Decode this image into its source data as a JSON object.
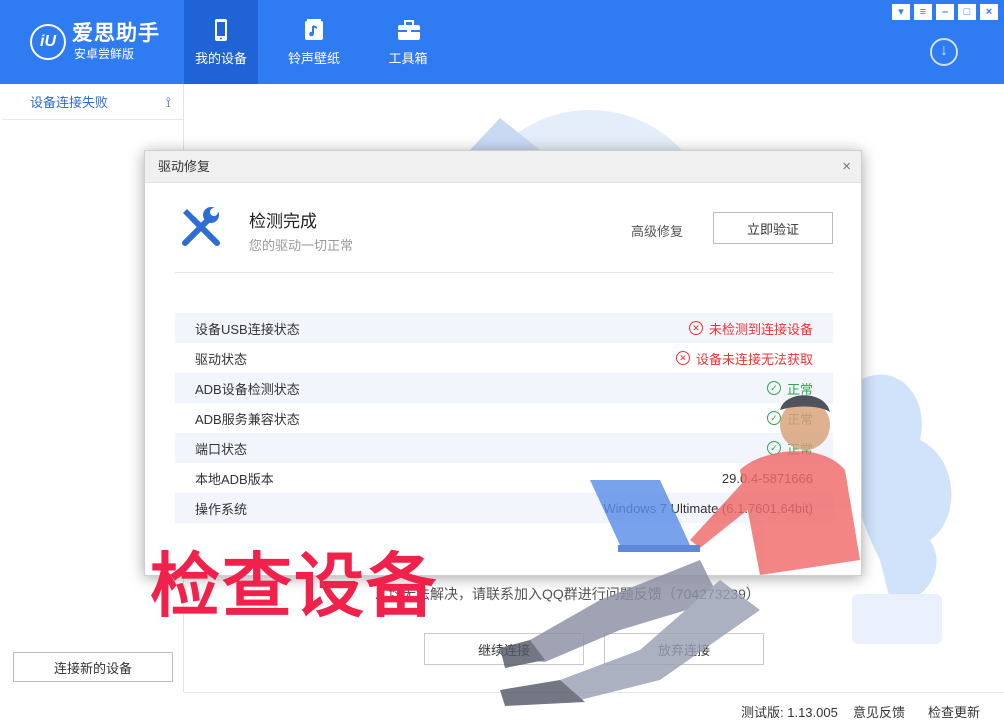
{
  "app": {
    "logo_mark": "iU",
    "logo_title": "爱思助手",
    "logo_subtitle": "安卓尝鲜版"
  },
  "nav": [
    {
      "label": "我的设备",
      "icon": "phone-icon",
      "active": true
    },
    {
      "label": "铃声壁纸",
      "icon": "music-icon",
      "active": false
    },
    {
      "label": "工具箱",
      "icon": "toolbox-icon",
      "active": false
    }
  ],
  "window_buttons": [
    "skin-icon",
    "menu-icon",
    "minimize-icon",
    "maximize-icon",
    "close-icon"
  ],
  "sidebar": {
    "status": "设备连接失败",
    "connect_new": "连接新的设备"
  },
  "background": {
    "hint_text": "…均无法解决，请联系加入QQ群进行问题反馈（704273239）",
    "continue_btn": "继续连接",
    "abandon_btn": "放弃连接"
  },
  "dialog": {
    "title": "驱动修复",
    "close": "×",
    "heading": "检测完成",
    "subheading": "您的驱动一切正常",
    "advanced": "高级修复",
    "verify": "立即验证",
    "rows": [
      {
        "label": "设备USB连接状态",
        "value": "未检测到连接设备",
        "status": "error"
      },
      {
        "label": "驱动状态",
        "value": "设备未连接无法获取",
        "status": "error"
      },
      {
        "label": "ADB设备检测状态",
        "value": "正常",
        "status": "ok"
      },
      {
        "label": "ADB服务兼容状态",
        "value": "正常",
        "status": "ok"
      },
      {
        "label": "端口状态",
        "value": "正常",
        "status": "ok"
      },
      {
        "label": "本地ADB版本",
        "value": "29.0.4-5871666",
        "status": "plain"
      },
      {
        "label": "操作系统",
        "value": "Windows 7 Ultimate (6.1.7601,64bit)",
        "status": "plain"
      }
    ]
  },
  "footer": {
    "version": "测试版: 1.13.005",
    "feedback": "意见反馈",
    "update": "检查更新"
  },
  "caption": "检查设备",
  "colors": {
    "primary": "#2e7bf2",
    "nav_active": "#1f63d6",
    "error": "#ee3333",
    "ok": "#2aa84a",
    "caption": "#f0214a"
  }
}
